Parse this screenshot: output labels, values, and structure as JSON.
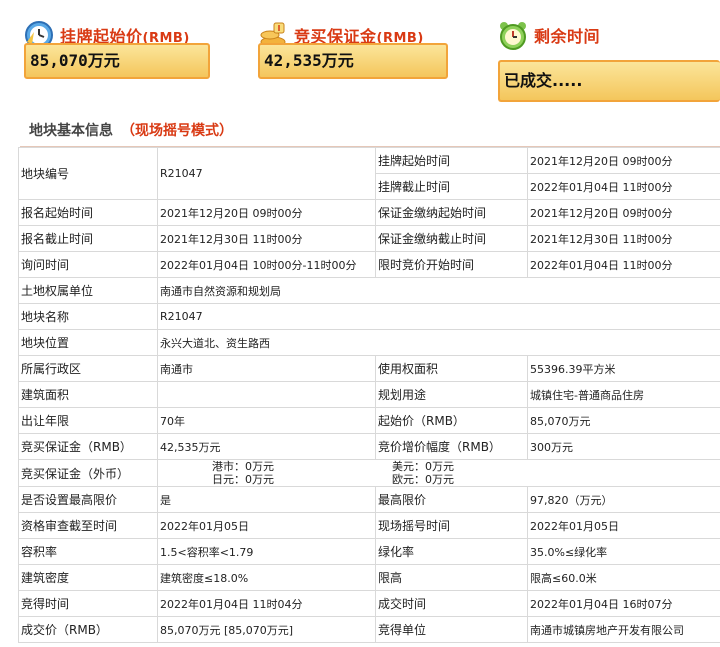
{
  "header": {
    "start_price": {
      "title": "挂牌起始价",
      "unit": "(RMB)",
      "value": "85,070万元",
      "icon": "clock-icon"
    },
    "deposit": {
      "title": "竞买保证金",
      "unit": "(RMB)",
      "value": "42,535万元",
      "icon": "coins-icon"
    },
    "remaining": {
      "title": "剩余时间",
      "value": "已成交.....",
      "icon": "alarm-clock-icon"
    }
  },
  "section": {
    "title": "地块基本信息",
    "mode": "（现场摇号模式）"
  },
  "table": {
    "r1": {
      "l1": "地块编号",
      "v1": "R21047",
      "l2a": "挂牌起始时间",
      "v2a": "2021年12月20日 09时00分",
      "l2b": "挂牌截止时间",
      "v2b": "2022年01月04日 11时00分"
    },
    "r2": {
      "l1": "报名起始时间",
      "v1": "2021年12月20日 09时00分",
      "l2": "保证金缴纳起始时间",
      "v2": "2021年12月20日 09时00分"
    },
    "r3": {
      "l1": "报名截止时间",
      "v1": "2021年12月30日 11时00分",
      "l2": "保证金缴纳截止时间",
      "v2": "2021年12月30日 11时00分"
    },
    "r4": {
      "l1": "询问时间",
      "v1": "2022年01月04日 10时00分-11时00分",
      "l2": "限时竞价开始时间",
      "v2": "2022年01月04日 11时00分"
    },
    "r5": {
      "l1": "土地权属单位",
      "v1": "南通市自然资源和规划局"
    },
    "r6": {
      "l1": "地块名称",
      "v1": "R21047"
    },
    "r7": {
      "l1": "地块位置",
      "v1": "永兴大道北、资生路西"
    },
    "r8": {
      "l1": "所属行政区",
      "v1": "南通市",
      "l2": "使用权面积",
      "v2": "55396.39平方米"
    },
    "r9": {
      "l1": "建筑面积",
      "v1": "",
      "l2": "规划用途",
      "v2": "城镇住宅-普通商品住房"
    },
    "r10": {
      "l1": "出让年限",
      "v1": "70年",
      "l2": "起始价（RMB）",
      "v2": "85,070万元"
    },
    "r11": {
      "l1": "竞买保证金（RMB）",
      "v1": "42,535万元",
      "l2": "竞价增价幅度（RMB）",
      "v2": "300万元"
    },
    "r12": {
      "l1": "竞买保证金（外币）",
      "hk": "港市：0万元",
      "jp": "日元：0万元",
      "us": "美元：0万元",
      "eu": "欧元：0万元"
    },
    "r13": {
      "l1": "是否设置最高限价",
      "v1": "是",
      "l2": "最高限价",
      "v2": "97,820（万元）"
    },
    "r14": {
      "l1": "资格审查截至时间",
      "v1": "2022年01月05日",
      "l2": "现场摇号时间",
      "v2": "2022年01月05日"
    },
    "r15": {
      "l1": "容积率",
      "v1": "1.5<容积率<1.79",
      "l2": "绿化率",
      "v2": "35.0%≤绿化率"
    },
    "r16": {
      "l1": "建筑密度",
      "v1": "建筑密度≤18.0%",
      "l2": "限高",
      "v2": "限高≤60.0米"
    },
    "r17": {
      "l1": "竞得时间",
      "v1": "2022年01月04日 11时04分",
      "l2": "成交时间",
      "v2": "2022年01月04日 16时07分"
    },
    "r18": {
      "l1": "成交价（RMB）",
      "v1": "85,070万元 [85,070万元]",
      "l2": "竞得单位",
      "v2": "南通市城镇房地产开发有限公司"
    }
  }
}
